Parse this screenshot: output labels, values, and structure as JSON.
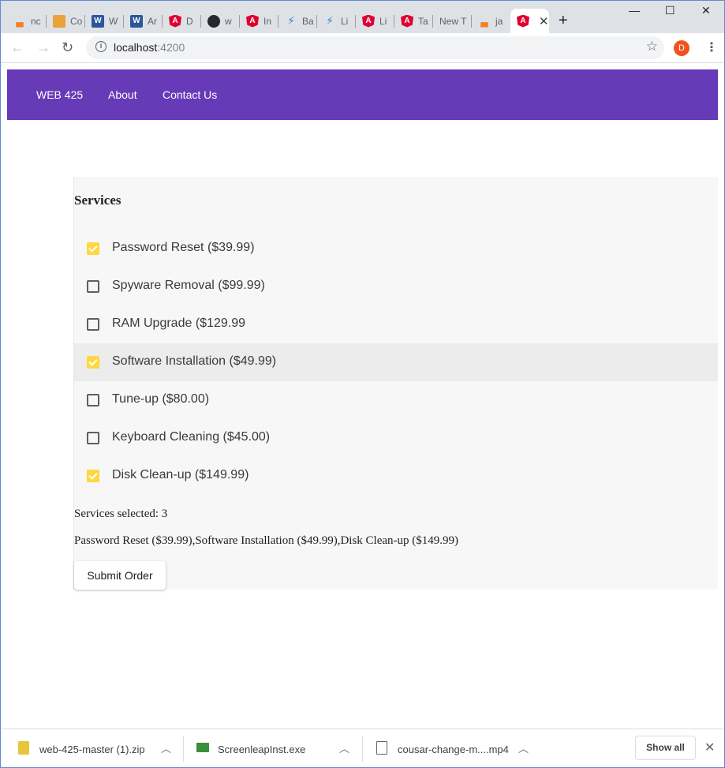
{
  "browser": {
    "tabs": [
      {
        "label": "nc",
        "icon": "stackoverflow-icon"
      },
      {
        "label": "Co",
        "icon": "pen-icon"
      },
      {
        "label": "W",
        "icon": "word-icon"
      },
      {
        "label": "Ar",
        "icon": "word-icon"
      },
      {
        "label": "D",
        "icon": "angular-icon"
      },
      {
        "label": "w",
        "icon": "github-icon"
      },
      {
        "label": "In",
        "icon": "angular-icon"
      },
      {
        "label": "Ba",
        "icon": "bolt-icon"
      },
      {
        "label": "Li",
        "icon": "bolt-icon"
      },
      {
        "label": "Li",
        "icon": "angular-icon"
      },
      {
        "label": "Ta",
        "icon": "angular-icon"
      },
      {
        "label": "New T",
        "icon": ""
      },
      {
        "label": "ja",
        "icon": "stackoverflow-icon"
      }
    ],
    "active_tab_icon": "angular-icon",
    "close_tab_glyph": "✕",
    "new_tab_glyph": "+",
    "window_controls": {
      "minimize": "—",
      "maximize": "☐",
      "close": "✕"
    },
    "url_host": "localhost",
    "url_port": ":4200",
    "profile_initial": "D"
  },
  "app": {
    "brand": "WEB 425",
    "nav": [
      "About",
      "Contact Us"
    ],
    "colors": {
      "navbar": "#673ab7",
      "checkbox_accent": "#ffd740"
    }
  },
  "services": {
    "title": "Services",
    "items": [
      {
        "label": "Password Reset ($39.99)",
        "checked": true
      },
      {
        "label": "Spyware Removal ($99.99)",
        "checked": false
      },
      {
        "label": "RAM Upgrade ($129.99",
        "checked": false
      },
      {
        "label": "Software Installation ($49.99)",
        "checked": true
      },
      {
        "label": "Tune-up ($80.00)",
        "checked": false
      },
      {
        "label": "Keyboard Cleaning ($45.00)",
        "checked": false
      },
      {
        "label": "Disk Clean-up ($149.99)",
        "checked": true
      }
    ],
    "selected_count_text": "Services selected: 3",
    "selected_list_text": "Password Reset ($39.99),Software Installation ($49.99),Disk Clean-up ($149.99)",
    "submit_label": "Submit Order"
  },
  "downloads": {
    "items": [
      {
        "name": "web-425-master (1).zip",
        "icon": "zip-file-icon"
      },
      {
        "name": "ScreenleapInst.exe",
        "icon": "exe-file-icon"
      },
      {
        "name": "cousar-change-m....mp4",
        "icon": "video-file-icon"
      }
    ],
    "show_all_label": "Show all",
    "close_glyph": "✕"
  }
}
